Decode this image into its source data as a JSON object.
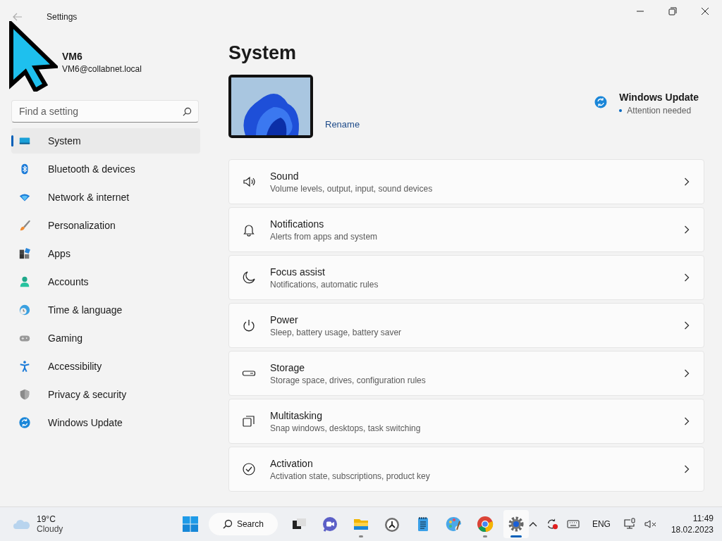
{
  "window": {
    "title": "Settings"
  },
  "user": {
    "name": "VM6",
    "email": "VM6@collabnet.local"
  },
  "search": {
    "placeholder": "Find a setting"
  },
  "sidebar": {
    "items": [
      {
        "label": "System",
        "kind": "display",
        "selected": true
      },
      {
        "label": "Bluetooth & devices",
        "kind": "bluetooth",
        "selected": false
      },
      {
        "label": "Network & internet",
        "kind": "wifi",
        "selected": false
      },
      {
        "label": "Personalization",
        "kind": "brush",
        "selected": false
      },
      {
        "label": "Apps",
        "kind": "apps",
        "selected": false
      },
      {
        "label": "Accounts",
        "kind": "person",
        "selected": false
      },
      {
        "label": "Time & language",
        "kind": "clock",
        "selected": false
      },
      {
        "label": "Gaming",
        "kind": "gamepad",
        "selected": false
      },
      {
        "label": "Accessibility",
        "kind": "accessibility",
        "selected": false
      },
      {
        "label": "Privacy & security",
        "kind": "shield",
        "selected": false
      },
      {
        "label": "Windows Update",
        "kind": "sync",
        "selected": false
      }
    ]
  },
  "page": {
    "title": "System",
    "rename": "Rename",
    "update": {
      "title": "Windows Update",
      "status": "Attention needed"
    }
  },
  "settings": [
    {
      "kind": "speaker",
      "title": "Sound",
      "subtitle": "Volume levels, output, input, sound devices"
    },
    {
      "kind": "bell",
      "title": "Notifications",
      "subtitle": "Alerts from apps and system"
    },
    {
      "kind": "moon",
      "title": "Focus assist",
      "subtitle": "Notifications, automatic rules"
    },
    {
      "kind": "power",
      "title": "Power",
      "subtitle": "Sleep, battery usage, battery saver"
    },
    {
      "kind": "drive",
      "title": "Storage",
      "subtitle": "Storage space, drives, configuration rules"
    },
    {
      "kind": "windows",
      "title": "Multitasking",
      "subtitle": "Snap windows, desktops, task switching"
    },
    {
      "kind": "check",
      "title": "Activation",
      "subtitle": "Activation state, subscriptions, product key"
    }
  ],
  "taskbar": {
    "weather": {
      "temperature": "19°C",
      "condition": "Cloudy"
    },
    "search": "Search",
    "apps": [
      {
        "kind": "task-view",
        "running": false,
        "active": false
      },
      {
        "kind": "chat",
        "running": false,
        "active": false
      },
      {
        "kind": "folder",
        "running": true,
        "active": false
      },
      {
        "kind": "clock",
        "running": false,
        "active": false
      },
      {
        "kind": "notepad",
        "running": false,
        "active": false
      },
      {
        "kind": "paint",
        "running": false,
        "active": false
      },
      {
        "kind": "browser",
        "running": true,
        "active": false
      },
      {
        "kind": "gear",
        "running": true,
        "active": true
      }
    ],
    "tray": {
      "language": "ENG",
      "time": "11:49",
      "date": "18.02.2023"
    }
  }
}
